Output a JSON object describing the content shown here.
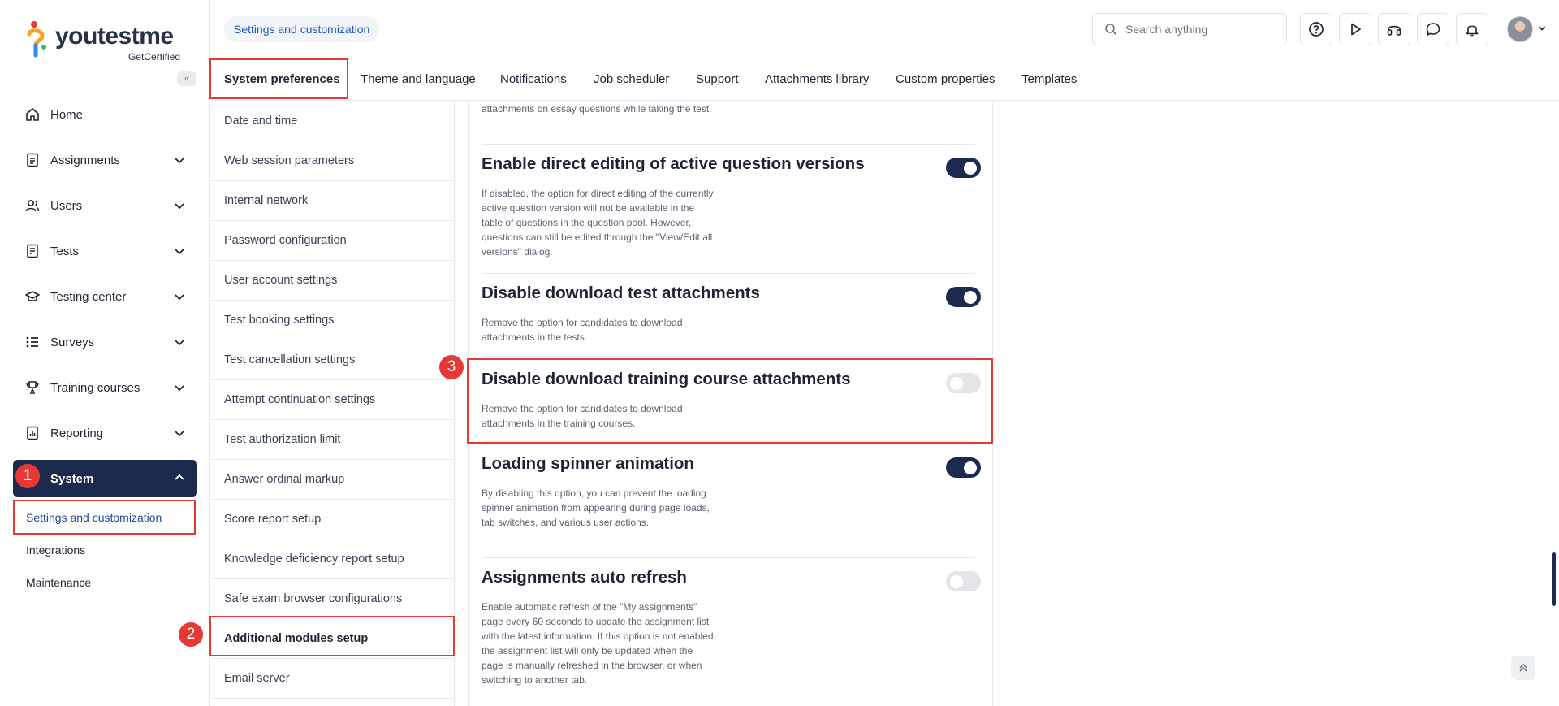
{
  "brand": {
    "name_prefix": "youtest",
    "name_suffix": "me",
    "tagline": "GetCertified"
  },
  "sidebar": {
    "collapse_icon": "«",
    "items": [
      {
        "label": "Home",
        "icon": "home-icon"
      },
      {
        "label": "Assignments",
        "icon": "assignments-icon"
      },
      {
        "label": "Users",
        "icon": "users-icon"
      },
      {
        "label": "Tests",
        "icon": "tests-icon"
      },
      {
        "label": "Testing center",
        "icon": "testing-center-icon"
      },
      {
        "label": "Surveys",
        "icon": "surveys-icon"
      },
      {
        "label": "Training courses",
        "icon": "trophy-icon"
      },
      {
        "label": "Reporting",
        "icon": "reporting-icon"
      },
      {
        "label": "System",
        "icon": "system-icon"
      }
    ],
    "subitems": [
      "Settings and customization",
      "Integrations",
      "Maintenance"
    ]
  },
  "markers": {
    "m1": "1",
    "m2": "2",
    "m3": "3"
  },
  "header": {
    "breadcrumb": "Settings and customization",
    "search_placeholder": "Search anything"
  },
  "tabs": [
    "System preferences",
    "Theme and language",
    "Notifications",
    "Job scheduler",
    "Support",
    "Attachments library",
    "Custom properties",
    "Templates"
  ],
  "settings_list": [
    "Date and time",
    "Web session parameters",
    "Internal network",
    "Password configuration",
    "User account settings",
    "Test booking settings",
    "Test cancellation settings",
    "Attempt continuation settings",
    "Test authorization limit",
    "Answer ordinal markup",
    "Score report setup",
    "Knowledge deficiency report setup",
    "Safe exam browser configurations",
    "Additional modules setup",
    "Email server"
  ],
  "content": {
    "top_fragment": "attachments on essay questions while taking the test.",
    "options": [
      {
        "title": "Enable direct editing of active question versions",
        "desc": "If disabled, the option for direct editing of the currently active question version will not be available in the table of questions in the question pool. However, questions can still be edited through the \"View/Edit all versions\" dialog.",
        "enabled": true
      },
      {
        "title": "Disable download test attachments",
        "desc": "Remove the option for candidates to download attachments in the tests.",
        "enabled": true
      },
      {
        "title": "Disable download training course attachments",
        "desc": "Remove the option for candidates to download attachments in the training courses.",
        "enabled": false
      },
      {
        "title": "Loading spinner animation",
        "desc": "By disabling this option, you can prevent the loading spinner animation from appearing during page loads, tab switches, and various user actions.",
        "enabled": true
      },
      {
        "title": "Assignments auto refresh",
        "desc": "Enable automatic refresh of the \"My assignments\" page every 60 seconds to update the assignment list with the latest information. If this option is not enabled, the assignment list will only be updated when the page is manually refreshed in the browser, or when switching to another tab.",
        "enabled": false
      }
    ]
  },
  "colors": {
    "primary": "#1c2a4f",
    "highlight": "#e53935",
    "link": "#1f57c3"
  }
}
